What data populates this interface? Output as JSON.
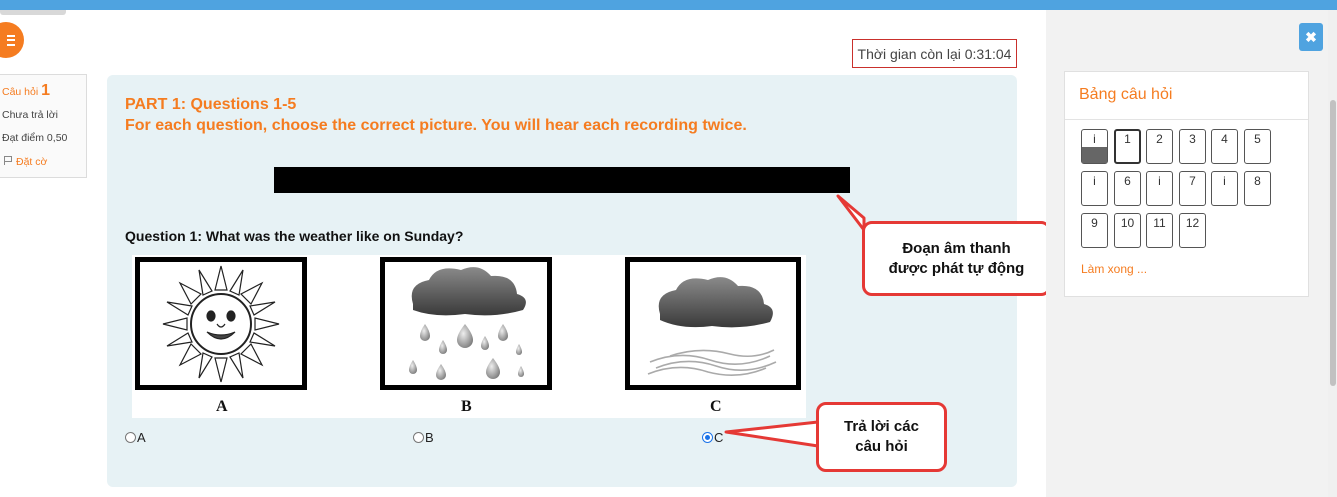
{
  "timer": {
    "text": "Thời gian còn lại 0:31:04"
  },
  "question_info": {
    "label": "Câu hỏi",
    "number": "1",
    "status": "Chưa trả lời",
    "score": "Đạt điểm 0,50",
    "flag_label": "Đặt cờ"
  },
  "part": {
    "title": "PART 1: Questions 1-5",
    "instructions": "For each question, choose the correct picture. You will hear each recording twice."
  },
  "question": {
    "text": "Question 1: What was the weather like on Sunday?",
    "pictures": [
      {
        "letter": "A",
        "icon": "sun-icon"
      },
      {
        "letter": "B",
        "icon": "rain-cloud-icon"
      },
      {
        "letter": "C",
        "icon": "wind-cloud-icon"
      }
    ],
    "options": [
      {
        "label": "A",
        "checked": false
      },
      {
        "label": "B",
        "checked": false
      },
      {
        "label": "C",
        "checked": true
      }
    ]
  },
  "callouts": {
    "audio": "Đoạn âm thanh được phát tự động",
    "answer": "Trả lời các câu hỏi"
  },
  "navigation": {
    "title": "Bảng câu hỏi",
    "finish_link": "Làm xong ...",
    "boxes": [
      "i",
      "1",
      "2",
      "3",
      "4",
      "5",
      "i",
      "6",
      "i",
      "7",
      "i",
      "8",
      "9",
      "10",
      "11",
      "12"
    ]
  },
  "colors": {
    "accent": "#f57c20",
    "topbar": "#4fa3e0",
    "callout_border": "#e53935",
    "content_bg": "#e7f2f5"
  }
}
